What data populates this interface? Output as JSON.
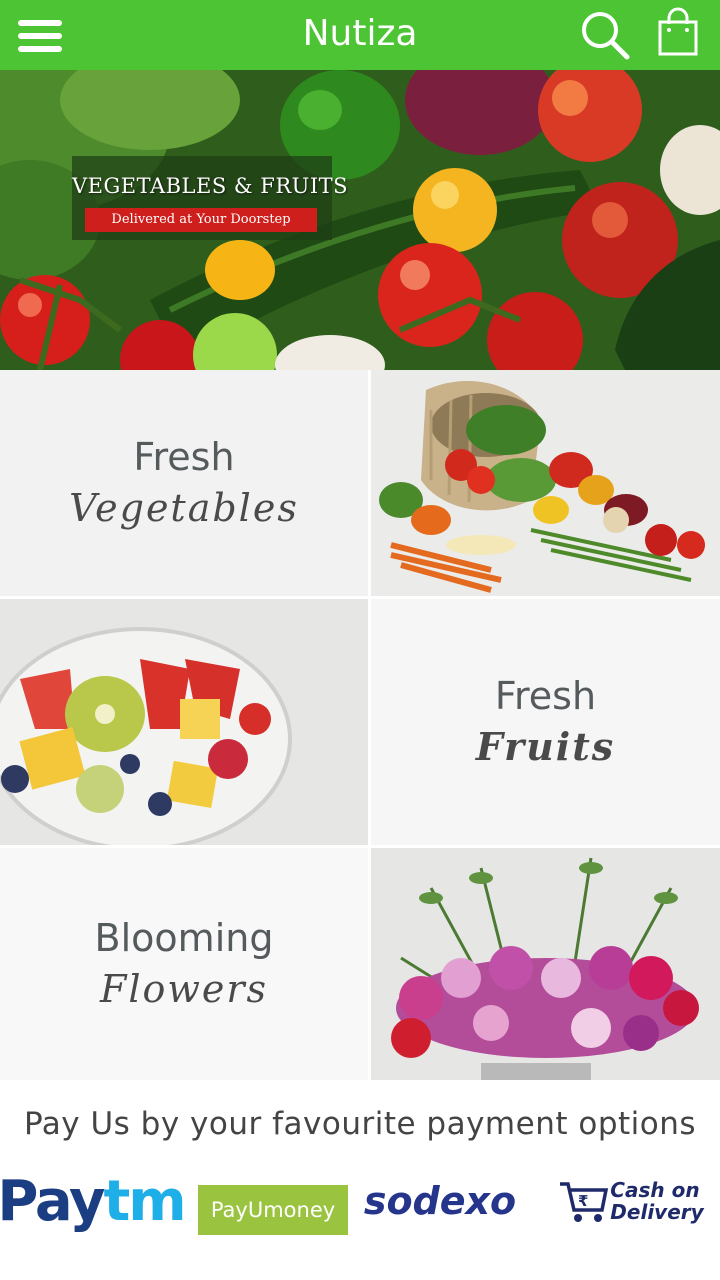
{
  "header": {
    "title": "Nutiza",
    "menu_icon": "hamburger-menu-icon",
    "search_icon": "search-icon",
    "cart_icon": "shopping-bag-icon",
    "background": "#4cc433"
  },
  "banner": {
    "title": "VEGETABLES & FRUITS",
    "subtitle": "Delivered at Your Doorstep"
  },
  "categories": [
    {
      "main": "Fresh",
      "script": "Vegetables"
    },
    {
      "main": "Fresh",
      "script": "Fruits"
    },
    {
      "main": "Blooming",
      "script": "Flowers"
    }
  ],
  "payment": {
    "heading": "Pay Us by your favourite payment options",
    "paytm": {
      "part1": "Pay",
      "part2": "tm"
    },
    "payumoney": "PayUmoney",
    "sodexo": "sodexo",
    "cod": {
      "line1": "Cash on",
      "line2": "Delivery",
      "currency": "₹"
    }
  }
}
